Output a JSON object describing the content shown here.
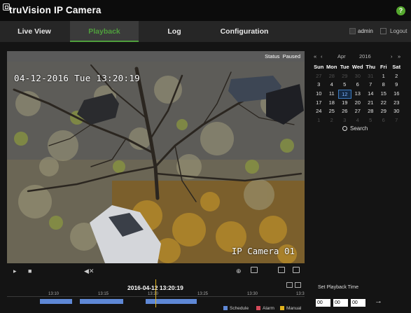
{
  "header": {
    "brand": "truVision IP Camera",
    "help_icon": "?"
  },
  "nav": {
    "tabs": [
      {
        "label": "Live View",
        "active": false
      },
      {
        "label": "Playback",
        "active": true
      },
      {
        "label": "Log",
        "active": false
      },
      {
        "label": "Configuration",
        "active": false
      }
    ],
    "user": "admin",
    "logout": "Logout"
  },
  "video": {
    "status_label": "Status",
    "status_value": "Paused",
    "osd_time": "04-12-2016 Tue 13:20:19",
    "osd_camera": "IP Camera 01"
  },
  "calendar": {
    "prev_year": "«",
    "prev_month": "‹",
    "month": "Apr",
    "year": "2016",
    "next_month": "›",
    "next_year": "»",
    "weekdays": [
      "Sun",
      "Mon",
      "Tue",
      "Wed",
      "Thu",
      "Fri",
      "Sat"
    ],
    "weeks": [
      [
        "27",
        "28",
        "29",
        "30",
        "31",
        "1",
        "2"
      ],
      [
        "3",
        "4",
        "5",
        "6",
        "7",
        "8",
        "9"
      ],
      [
        "10",
        "11",
        "12",
        "13",
        "14",
        "15",
        "16"
      ],
      [
        "17",
        "18",
        "19",
        "20",
        "21",
        "22",
        "23"
      ],
      [
        "24",
        "25",
        "26",
        "27",
        "28",
        "29",
        "30"
      ],
      [
        "1",
        "2",
        "3",
        "4",
        "5",
        "6",
        "7"
      ]
    ],
    "selected_day": "12",
    "search_label": "Search"
  },
  "timeline": {
    "current": "2016-04-12 13:20:19",
    "ticks": [
      "13:10",
      "13:15",
      "13:20",
      "13:25",
      "13:30",
      "13:3"
    ],
    "legend": [
      {
        "label": "Schedule",
        "color": "#5f88d6"
      },
      {
        "label": "Alarm",
        "color": "#d64a5a"
      },
      {
        "label": "Manual",
        "color": "#e0b21c"
      }
    ]
  },
  "playback_time": {
    "title": "Set Playback Time",
    "hour": "00",
    "minute": "00",
    "second": "00",
    "go": "→"
  }
}
